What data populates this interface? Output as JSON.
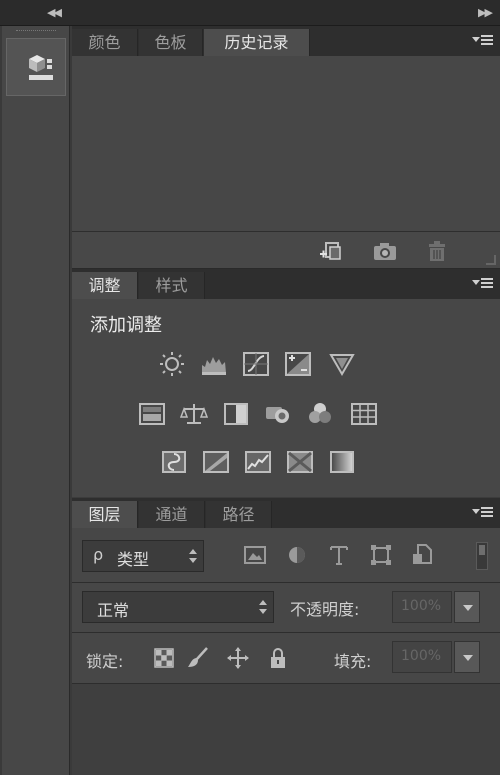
{
  "top_bar": {
    "collapse_left": "◀◀",
    "collapse_right": "▶▶"
  },
  "history_panel": {
    "tabs": [
      {
        "label": "颜色",
        "active": false
      },
      {
        "label": "色板",
        "active": false
      },
      {
        "label": "历史记录",
        "active": true
      }
    ],
    "footer_icons": [
      "new-document-from-state-icon",
      "snapshot-camera-icon",
      "trash-icon"
    ]
  },
  "adjustments_panel": {
    "tabs": [
      {
        "label": "调整",
        "active": true
      },
      {
        "label": "样式",
        "active": false
      }
    ],
    "add_label": "添加调整",
    "icon_rows": [
      [
        "brightness-contrast-icon",
        "levels-icon",
        "curves-icon",
        "exposure-icon",
        "vibrance-icon"
      ],
      [
        "hue-saturation-icon",
        "color-balance-icon",
        "black-white-icon",
        "photo-filter-icon",
        "channel-mixer-icon",
        "color-lookup-icon"
      ],
      [
        "invert-icon",
        "posterize-icon",
        "threshold-icon",
        "selective-color-icon",
        "gradient-map-icon"
      ]
    ]
  },
  "layers_panel": {
    "tabs": [
      {
        "label": "图层",
        "active": true
      },
      {
        "label": "通道",
        "active": false
      },
      {
        "label": "路径",
        "active": false
      }
    ],
    "filter": {
      "search_glyph": "ρ",
      "label": "类型"
    },
    "filter_icons": [
      "pixel-layer-filter-icon",
      "adjustment-layer-filter-icon",
      "type-layer-filter-icon",
      "shape-layer-filter-icon",
      "smart-object-filter-icon"
    ],
    "blend_mode": "正常",
    "opacity_label": "不透明度:",
    "opacity_value": "100%",
    "lock_label": "锁定:",
    "lock_icons": [
      "lock-transparent-pixels-icon",
      "lock-image-pixels-icon",
      "lock-position-icon",
      "lock-all-icon"
    ],
    "fill_label": "填充:",
    "fill_value": "100%"
  }
}
